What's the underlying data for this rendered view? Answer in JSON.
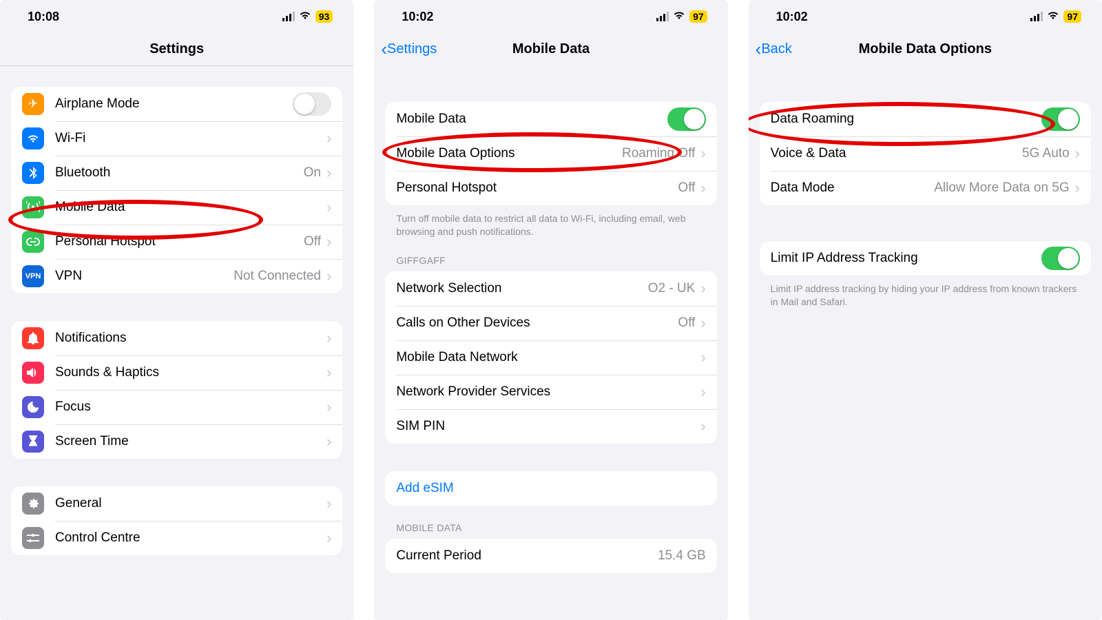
{
  "screens": {
    "settings": {
      "time": "10:08",
      "battery": "93",
      "title": "Settings",
      "rows1": {
        "airplane": "Airplane Mode",
        "wifi": "Wi-Fi",
        "bluetooth": "Bluetooth",
        "bluetooth_value": "On",
        "mobile_data": "Mobile Data",
        "hotspot": "Personal Hotspot",
        "hotspot_value": "Off",
        "vpn": "VPN",
        "vpn_value": "Not Connected"
      },
      "rows2": {
        "notifications": "Notifications",
        "sounds": "Sounds & Haptics",
        "focus": "Focus",
        "screentime": "Screen Time"
      },
      "rows3": {
        "general": "General",
        "controlcentre": "Control Centre"
      }
    },
    "mobiledata": {
      "time": "10:02",
      "battery": "97",
      "back": "Settings",
      "title": "Mobile Data",
      "rows1": {
        "mobile_data": "Mobile Data",
        "options": "Mobile Data Options",
        "options_value": "Roaming Off",
        "hotspot": "Personal Hotspot",
        "hotspot_value": "Off"
      },
      "foot1": "Turn off mobile data to restrict all data to Wi-Fi, including email, web browsing and push notifications.",
      "carrier_header": "GIFFGAFF",
      "rows2": {
        "network_sel": "Network Selection",
        "network_sel_value": "O2 - UK",
        "calls_other": "Calls on Other Devices",
        "calls_other_value": "Off",
        "mdn": "Mobile Data Network",
        "nps": "Network Provider Services",
        "simpin": "SIM PIN"
      },
      "add_esim": "Add eSIM",
      "data_header": "MOBILE DATA",
      "current_period": "Current Period",
      "current_period_value": "15.4 GB"
    },
    "options": {
      "time": "10:02",
      "battery": "97",
      "back": "Back",
      "title": "Mobile Data Options",
      "rows1": {
        "roaming": "Data Roaming",
        "voice_data": "Voice & Data",
        "voice_data_value": "5G Auto",
        "data_mode": "Data Mode",
        "data_mode_value": "Allow More Data on 5G"
      },
      "rows2": {
        "limit_ip": "Limit IP Address Tracking"
      },
      "foot2": "Limit IP address tracking by hiding your IP address from known trackers in Mail and Safari."
    }
  }
}
